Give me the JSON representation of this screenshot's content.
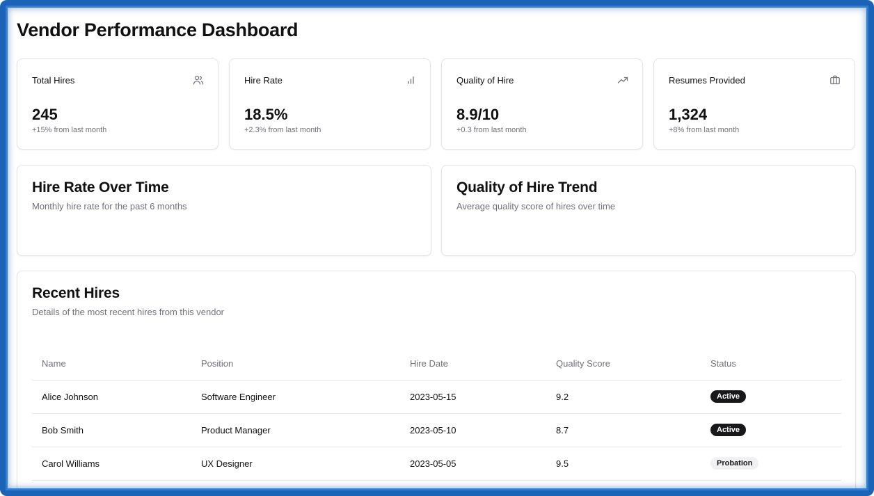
{
  "page": {
    "title": "Vendor Performance Dashboard"
  },
  "stats": [
    {
      "label": "Total Hires",
      "value": "245",
      "delta": "+15% from last month",
      "icon": "users-icon"
    },
    {
      "label": "Hire Rate",
      "value": "18.5%",
      "delta": "+2.3% from last month",
      "icon": "bar-chart-icon"
    },
    {
      "label": "Quality of Hire",
      "value": "8.9/10",
      "delta": "+0.3 from last month",
      "icon": "trending-up-icon"
    },
    {
      "label": "Resumes Provided",
      "value": "1,324",
      "delta": "+8% from last month",
      "icon": "briefcase-icon"
    }
  ],
  "charts": [
    {
      "title": "Hire Rate Over Time",
      "subtitle": "Monthly hire rate for the past 6 months"
    },
    {
      "title": "Quality of Hire Trend",
      "subtitle": "Average quality score of hires over time"
    }
  ],
  "recent": {
    "title": "Recent Hires",
    "subtitle": "Details of the most recent hires from this vendor",
    "columns": [
      "Name",
      "Position",
      "Hire Date",
      "Quality Score",
      "Status"
    ],
    "rows": [
      [
        "Alice Johnson",
        "Software Engineer",
        "2023-05-15",
        "9.2",
        "Active"
      ],
      [
        "Bob Smith",
        "Product Manager",
        "2023-05-10",
        "8.7",
        "Active"
      ],
      [
        "Carol Williams",
        "UX Designer",
        "2023-05-05",
        "9.5",
        "Probation"
      ]
    ]
  },
  "colors": {
    "frame": "#1b63b6",
    "badge_active": "#18181b",
    "badge_probation": "#f1f1f3",
    "muted_text": "#71717a"
  }
}
